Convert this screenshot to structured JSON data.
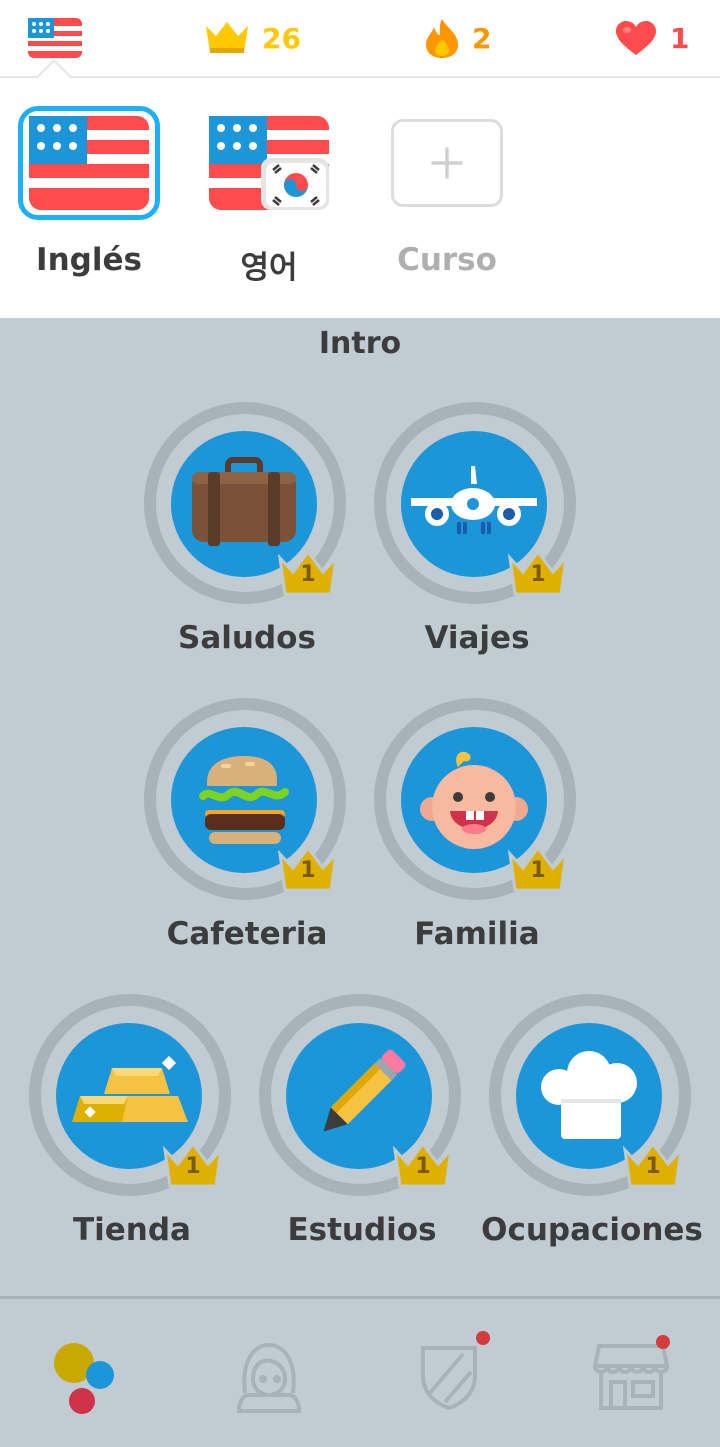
{
  "topbar": {
    "crowns": "26",
    "streak": "2",
    "hearts": "1",
    "colors": {
      "crown": "#ffc800",
      "streak": "#ff9600",
      "heart": "#ff4b4b"
    }
  },
  "courses": [
    {
      "label": "Inglés",
      "flag": "us-flag-icon",
      "selected": true
    },
    {
      "label": "영어",
      "flag": "us-korea-flag-icon",
      "selected": false
    },
    {
      "label": "Curso",
      "flag": "add-course-icon",
      "selected": false
    }
  ],
  "section": {
    "title": "Intro"
  },
  "skills": [
    {
      "name": "Saludos",
      "icon": "suitcase-icon",
      "level": "1"
    },
    {
      "name": "Viajes",
      "icon": "airplane-icon",
      "level": "1"
    },
    {
      "name": "Cafeteria",
      "icon": "burger-icon",
      "level": "1"
    },
    {
      "name": "Familia",
      "icon": "baby-face-icon",
      "level": "1"
    },
    {
      "name": "Tienda",
      "icon": "gold-bars-icon",
      "level": "1"
    },
    {
      "name": "Estudios",
      "icon": "pencil-icon",
      "level": "1"
    },
    {
      "name": "Ocupaciones",
      "icon": "chef-hat-icon",
      "level": "1"
    }
  ],
  "nav": [
    {
      "icon": "learn-icon",
      "active": true,
      "notification": false
    },
    {
      "icon": "profile-icon",
      "active": false,
      "notification": false
    },
    {
      "icon": "leaderboard-shield-icon",
      "active": false,
      "notification": true
    },
    {
      "icon": "shop-icon",
      "active": false,
      "notification": true
    }
  ],
  "colors": {
    "accent": "#1cb0f6",
    "skill_fill": "#1c96d8",
    "background": "#c0cbd2"
  }
}
